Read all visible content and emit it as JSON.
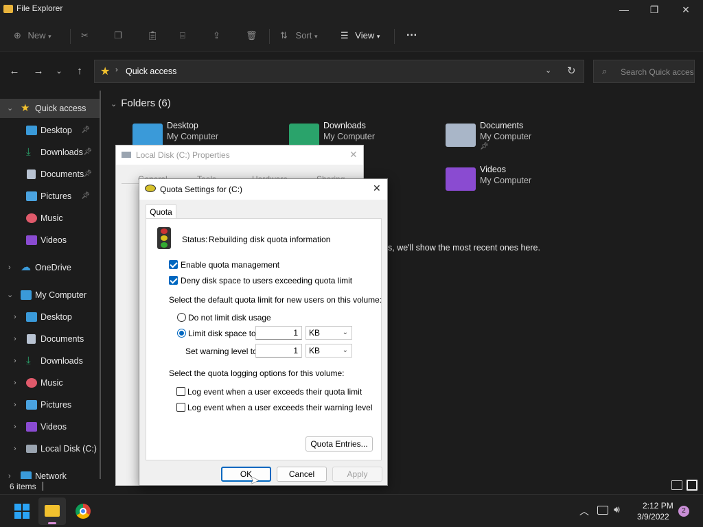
{
  "window": {
    "title": "File Explorer"
  },
  "toolbar": {
    "new_label": "New",
    "sort_label": "Sort",
    "view_label": "View",
    "more_label": "···"
  },
  "address": {
    "path": "Quick access",
    "search_placeholder": "Search Quick access"
  },
  "sidebar": {
    "quick_access": "Quick access",
    "qa_items": [
      "Desktop",
      "Downloads",
      "Documents",
      "Pictures",
      "Music",
      "Videos"
    ],
    "onedrive": "OneDrive",
    "my_computer": "My Computer",
    "mc_items": [
      "Desktop",
      "Documents",
      "Downloads",
      "Music",
      "Pictures",
      "Videos",
      "Local Disk (C:)"
    ],
    "network": "Network"
  },
  "main": {
    "folders_header": "Folders (6)",
    "folders": [
      {
        "name": "Desktop",
        "location": "My Computer"
      },
      {
        "name": "Downloads",
        "location": "My Computer"
      },
      {
        "name": "Documents",
        "location": "My Computer"
      },
      {
        "name": "Videos",
        "location": "My Computer"
      }
    ],
    "recent_hint": "s, we'll show the most recent ones here."
  },
  "statusbar": {
    "items_count": "6 items"
  },
  "taskbar": {
    "time": "2:12 PM",
    "date": "3/9/2022",
    "notif_count": "2"
  },
  "props_dialog": {
    "title": "Local Disk (C:) Properties",
    "tabs": [
      "General",
      "Tools",
      "Hardware",
      "Sharing"
    ]
  },
  "quota_dialog": {
    "title": "Quota Settings for  (C:)",
    "tab": "Quota",
    "status_label": "Status:",
    "status_value": "Rebuilding disk quota information",
    "enable_quota": "Enable quota management",
    "deny_space": "Deny disk space to users exceeding quota limit",
    "default_limit_heading": "Select the default quota limit for new users on this volume:",
    "no_limit": "Do not limit disk usage",
    "limit_to": "Limit disk space to",
    "limit_value": "1",
    "limit_unit": "KB",
    "warning_label": "Set warning level to",
    "warning_value": "1",
    "warning_unit": "KB",
    "logging_heading": "Select the quota logging options for this volume:",
    "log_limit": "Log event when a user exceeds their quota limit",
    "log_warning": "Log event when a user exceeds their warning level",
    "quota_entries": "Quota Entries...",
    "ok": "OK",
    "cancel": "Cancel",
    "apply": "Apply"
  },
  "colors": {
    "accent": "#0067c0",
    "folder_blue": "#3a9ad9",
    "folder_green": "#2aa36b",
    "folder_purple": "#8a4bd1"
  }
}
